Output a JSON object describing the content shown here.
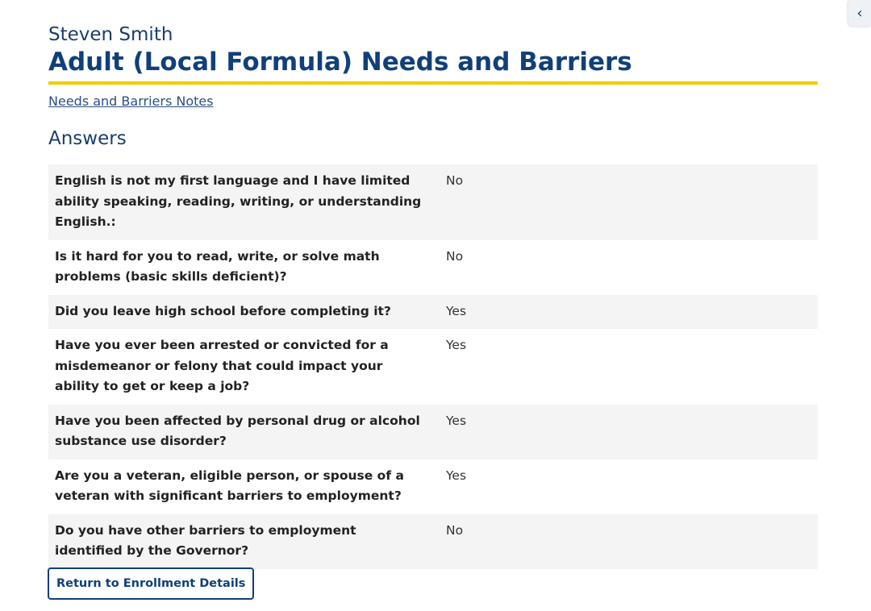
{
  "header": {
    "person_name": "Steven Smith",
    "title": "Adult (Local Formula) Needs and Barriers",
    "notes_link": "Needs and Barriers Notes"
  },
  "answers": {
    "heading": "Answers",
    "rows": [
      {
        "question": "English is not my first language and I have limited ability speaking, reading, writing, or understanding English.:",
        "answer": "No"
      },
      {
        "question": "Is it hard for you to read, write, or solve math problems (basic skills deficient)?",
        "answer": "No"
      },
      {
        "question": "Did you leave high school before completing it?",
        "answer": "Yes"
      },
      {
        "question": "Have you ever been arrested or convicted for a misdemeanor or felony that could impact your ability to get or keep a job?",
        "answer": "Yes"
      },
      {
        "question": "Have you been affected by personal drug or alcohol substance use disorder?",
        "answer": "Yes"
      },
      {
        "question": "Are you a veteran, eligible person, or spouse of a veteran with significant barriers to employment?",
        "answer": "Yes"
      },
      {
        "question": "Do you have other barriers to employment identified by the Governor?",
        "answer": "No"
      }
    ]
  },
  "footer": {
    "return_button": "Return to Enrollment Details"
  },
  "side_tab": {
    "icon": "chevron-left-icon"
  },
  "colors": {
    "title": "#113f7a",
    "accent_rule": "#f2cd00",
    "row_stripe": "#f4f4f4"
  }
}
